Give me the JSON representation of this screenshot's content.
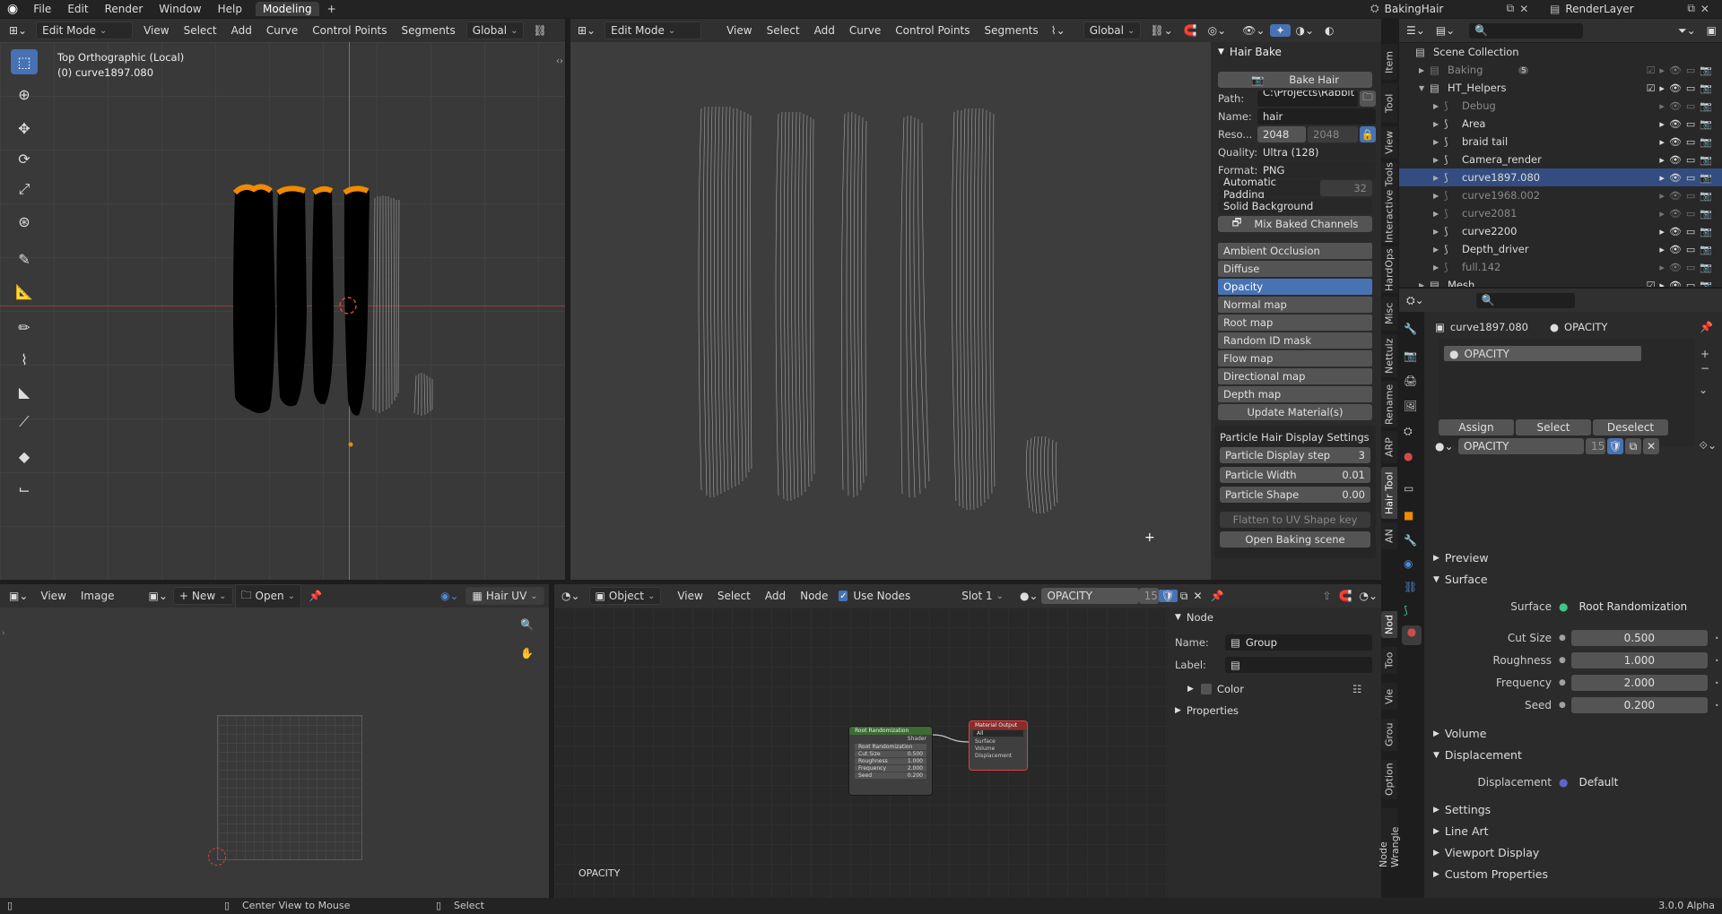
{
  "menu": {
    "items": [
      "File",
      "Edit",
      "Render",
      "Window",
      "Help"
    ],
    "workspace_tab": "Modeling",
    "add_tab": "+",
    "scene_name": "BakingHair",
    "view_layer": "RenderLayer"
  },
  "viewport_left": {
    "mode": "Edit Mode",
    "menus": [
      "View",
      "Select",
      "Add",
      "Curve",
      "Control Points",
      "Segments"
    ],
    "orientation": "Global",
    "view_label": "Top Orthographic (Local)",
    "object_label": "(0) curve1897.080"
  },
  "viewport_right": {
    "mode": "Edit Mode",
    "menus": [
      "View",
      "Select",
      "Add",
      "Curve",
      "Control Points",
      "Segments"
    ],
    "orientation": "Global"
  },
  "hair_bake": {
    "title": "Hair Bake",
    "bake_button": "Bake Hair",
    "path_label": "Path:",
    "path_value": "C:\\Projects\\Rabbit ...",
    "name_label": "Name:",
    "name_value": "hair",
    "reso_label": "Reso...",
    "reso_x": "2048",
    "reso_y": "2048",
    "quality_label": "Quality:",
    "quality_value": "Ultra (128)",
    "format_label": "Format:",
    "format_value": "PNG",
    "padding_label": "Automatic Padding",
    "padding_value": "32",
    "background_value": "Solid Background",
    "mix_button": "Mix Baked Channels",
    "channels": [
      "Ambient Occlusion",
      "Diffuse",
      "Opacity",
      "Normal map",
      "Root map",
      "Random ID mask",
      "Flow map",
      "Directional map",
      "Depth map"
    ],
    "selected_channel": "Opacity",
    "update_button": "Update Material(s)",
    "particle_title": "Particle Hair Display Settings",
    "particle_step_label": "Particle Display step",
    "particle_step_value": "3",
    "particle_width_label": "Particle Width",
    "particle_width_value": "0.01",
    "particle_shape_label": "Particle Shape",
    "particle_shape_value": "0.00",
    "flatten_button": "Flatten to UV Shape key",
    "open_scene_button": "Open Baking scene"
  },
  "side_tabs": [
    "Item",
    "Tool",
    "View",
    "Interactive Tools",
    "HardOps",
    "Misc",
    "Nettulz",
    "Rename",
    "ARP",
    "Hair Tool",
    "AN"
  ],
  "outliner": {
    "rows": [
      {
        "name": "Scene Collection",
        "indent": 0
      },
      {
        "name": "Baking",
        "indent": 1,
        "dim": true
      },
      {
        "name": "HT_Helpers",
        "indent": 1
      },
      {
        "name": "Debug",
        "indent": 2,
        "dim": true
      },
      {
        "name": "Area",
        "indent": 2
      },
      {
        "name": "braid tail",
        "indent": 2
      },
      {
        "name": "Camera_render",
        "indent": 2
      },
      {
        "name": "curve1897.080",
        "indent": 2,
        "sel": true
      },
      {
        "name": "curve1968.002",
        "indent": 2,
        "dim": true
      },
      {
        "name": "curve2081",
        "indent": 2,
        "dim": true
      },
      {
        "name": "curve2200",
        "indent": 2
      },
      {
        "name": "Depth_driver",
        "indent": 2
      },
      {
        "name": "full.142",
        "indent": 2,
        "dim": true
      },
      {
        "name": "Mesh",
        "indent": 1
      }
    ],
    "baking_badge": "5"
  },
  "material_panel": {
    "object": "curve1897.080",
    "material": "OPACITY",
    "slot_item": "OPACITY",
    "assign": "Assign",
    "select": "Select",
    "deselect": "Deselect",
    "mat_field": "OPACITY",
    "users": "15",
    "preview": "Preview",
    "surface_section": "Surface",
    "surface_label": "Surface",
    "surface_value": "Root Randomization",
    "params": [
      {
        "label": "Cut Size",
        "value": "0.500"
      },
      {
        "label": "Roughness",
        "value": "1.000"
      },
      {
        "label": "Frequency",
        "value": "2.000"
      },
      {
        "label": "Seed",
        "value": "0.200"
      }
    ],
    "volume": "Volume",
    "displacement_section": "Displacement",
    "displacement_label": "Displacement",
    "displacement_value": "Default",
    "collapsed": [
      "Settings",
      "Line Art",
      "Viewport Display",
      "Custom Properties"
    ]
  },
  "image_editor": {
    "menus": [
      "View",
      "Image"
    ],
    "new_button": "New",
    "open_button": "Open",
    "uv_label": "Hair UV"
  },
  "node_editor": {
    "object_mode": "Object",
    "menus": [
      "View",
      "Select",
      "Add",
      "Node"
    ],
    "use_nodes": "Use Nodes",
    "slot": "Slot 1",
    "material": "OPACITY",
    "users": "15",
    "canvas_label": "OPACITY",
    "node_panel_title": "Node",
    "name_label": "Name:",
    "name_value": "Group",
    "label_label": "Label:",
    "color_label": "Color",
    "properties_label": "Properties",
    "group_node": {
      "title": "Root Randomization",
      "out": "Shader",
      "field": "Root Randomization",
      "rows": [
        {
          "k": "Cut Size",
          "v": "0.500"
        },
        {
          "k": "Roughness",
          "v": "1.000"
        },
        {
          "k": "Frequency",
          "v": "2.000"
        },
        {
          "k": "Seed",
          "v": "0.200"
        }
      ]
    },
    "output_node": {
      "title": "Material Output",
      "target": "All",
      "rows": [
        "Surface",
        "Volume",
        "Displacement"
      ]
    },
    "side_tabs": [
      "Nod",
      "Too",
      "Vie",
      "Grou",
      "Option",
      "Node Wrangle"
    ]
  },
  "status": {
    "left": "Center View to Mouse",
    "mid": "Select",
    "version": "3.0.0 Alpha"
  }
}
